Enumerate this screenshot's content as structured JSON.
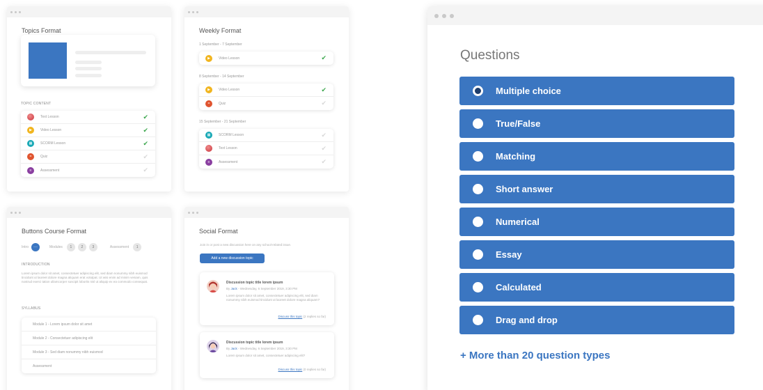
{
  "topics": {
    "title": "Topics Format",
    "section_label": "TOPIC CONTENT",
    "items": [
      {
        "label": "Text Lesson",
        "icon": "text-lesson-icon",
        "done": true
      },
      {
        "label": "Video Lesson",
        "icon": "video-lesson-icon",
        "done": true
      },
      {
        "label": "SCORM Lesson",
        "icon": "scorm-lesson-icon",
        "done": true
      },
      {
        "label": "Quiz",
        "icon": "quiz-icon",
        "done": false
      },
      {
        "label": "Assessment",
        "icon": "assessment-icon",
        "done": false
      }
    ]
  },
  "weekly": {
    "title": "Weekly Format",
    "weeks": [
      {
        "date": "1 September - 7 September",
        "items": [
          {
            "label": "Video Lesson",
            "icon": "video-lesson-icon",
            "done": true
          }
        ]
      },
      {
        "date": "8 September - 14 September",
        "items": [
          {
            "label": "Video Lesson",
            "icon": "video-lesson-icon",
            "done": true
          },
          {
            "label": "Quiz",
            "icon": "quiz-icon",
            "done": false
          }
        ]
      },
      {
        "date": "15 September - 21 September",
        "items": [
          {
            "label": "SCORM Lesson",
            "icon": "scorm-lesson-icon",
            "done": false
          },
          {
            "label": "Text Lesson",
            "icon": "text-lesson-icon",
            "done": false
          },
          {
            "label": "Assessment",
            "icon": "assessment-icon",
            "done": false
          }
        ]
      }
    ]
  },
  "buttons_course": {
    "title": "Buttons Course Format",
    "steps": {
      "intro_label": "Intro",
      "intro_value": "···",
      "modules_label": "Modules",
      "modules": [
        "1",
        "2",
        "3"
      ],
      "assessment_label": "Assessment",
      "assessment": "1"
    },
    "intro_heading": "INTRODUCTION",
    "intro_text": "Lorem ipsum dolor sit amet, consectetuer adipiscing elit, sed diam nonummy nibh euismod tincidunt ut laoreet dolore magna aliquam erat volutpat. Ut wisi enim ad minim veniam, quis nostrud exerci tation ullamcorper suscipit lobortis nisl ut aliquip ex ea commodo consequat.",
    "syllabus_heading": "SYLLABUS",
    "syllabus": [
      "Module 1 - Lorem ipsum dolor sit amet",
      "Module 2 - Consectetuer adipiscing elit",
      "Module 3 - Sed diam nonummy nibh euismod",
      "Assessment"
    ]
  },
  "social": {
    "title": "Social Format",
    "intro": "Join in or post a new discussion here on any school-related issue.",
    "button_label": "Add a new discussion topic",
    "posts": [
      {
        "title": "Discussion topic title lorem ipsum",
        "by": "By ",
        "author": "Jack",
        "date": " - Wednesday, 6 September 2019, 3:30 PM",
        "body": "Lorem ipsum dolor sit amet, consectetuer adipiscing elit, sed diam nonummy nibh euismod tincidunt ut laoreet dolore magna aliquam?",
        "link": "Discuss this topic",
        "replies": " (2 replies so far)"
      },
      {
        "title": "Discussion topic title lorem ipsum",
        "by": "By ",
        "author": "Jack",
        "date": " - Wednesday, 6 September 2019, 3:30 PM",
        "body": "Lorem ipsum dolor sit amet, consectetuer adipiscing elit?",
        "link": "Discuss this topic",
        "replies": " (0 replies so far)"
      }
    ]
  },
  "questions": {
    "title": "Questions",
    "options": [
      {
        "label": "Multiple choice",
        "selected": true
      },
      {
        "label": "True/False",
        "selected": false
      },
      {
        "label": "Matching",
        "selected": false
      },
      {
        "label": "Short answer",
        "selected": false
      },
      {
        "label": "Numerical",
        "selected": false
      },
      {
        "label": "Essay",
        "selected": false
      },
      {
        "label": "Calculated",
        "selected": false
      },
      {
        "label": "Drag and drop",
        "selected": false
      }
    ],
    "more_link": "+ More than 20 question types"
  },
  "colors": {
    "accent": "#3b76c1",
    "check": "#3aa64b"
  }
}
